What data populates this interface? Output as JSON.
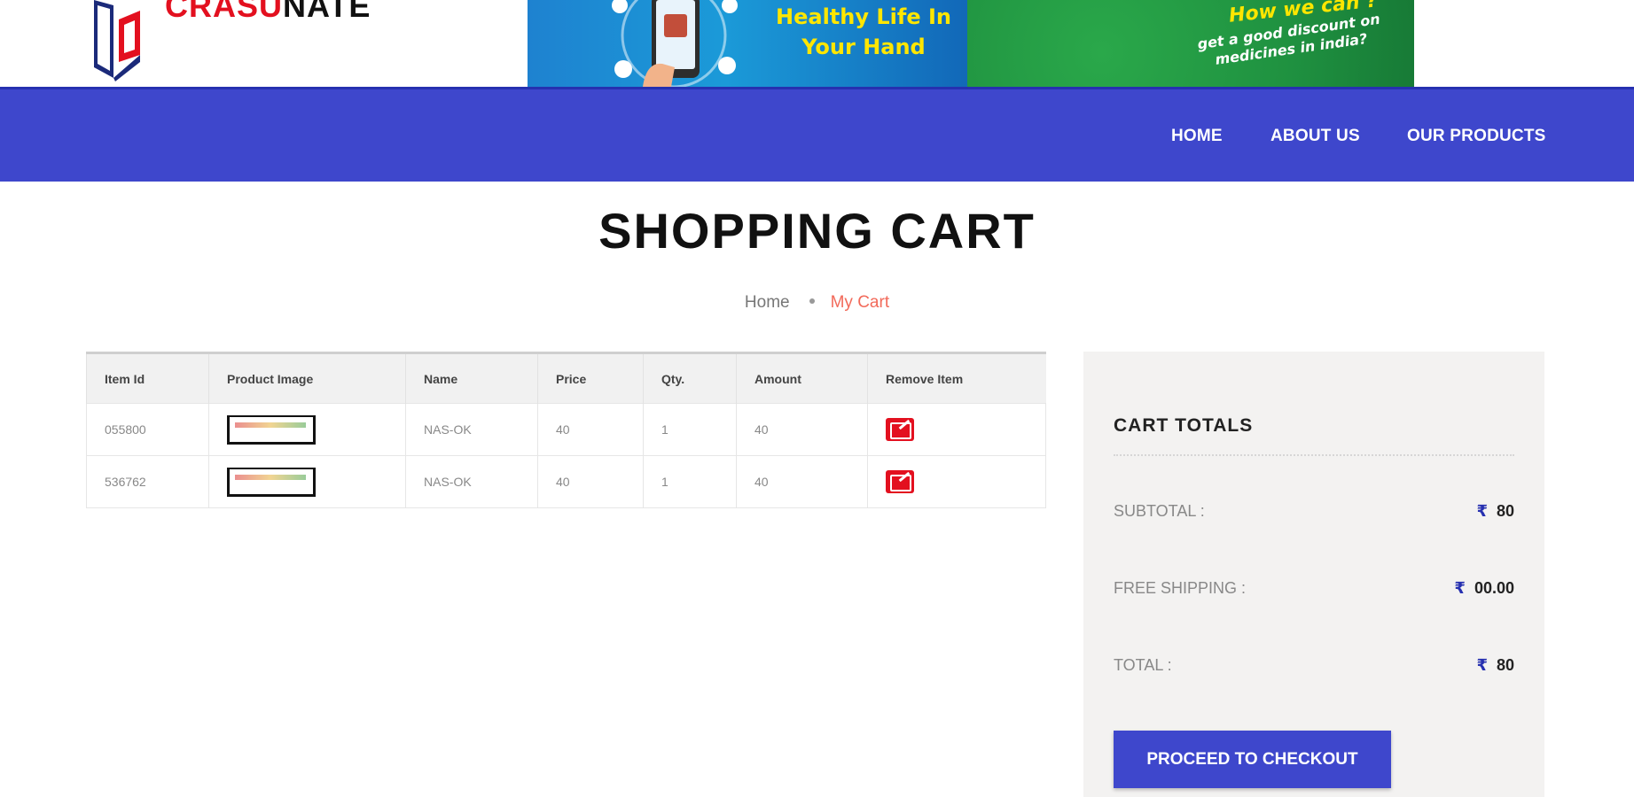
{
  "header": {
    "logo": {
      "text_red": "CRASU",
      "text_black": "NATE"
    },
    "banner": {
      "left_text": "Healthy Life In Your Hand",
      "right_text": "How we can ?",
      "right_subtext": "get a good discount on medicines in india?"
    }
  },
  "nav": {
    "items": [
      {
        "label": "HOME"
      },
      {
        "label": "ABOUT US"
      },
      {
        "label": "OUR PRODUCTS"
      }
    ]
  },
  "page": {
    "title": "SHOPPING CART",
    "breadcrumb": {
      "home": "Home",
      "current": "My Cart"
    }
  },
  "cart": {
    "columns": [
      "Item Id",
      "Product Image",
      "Name",
      "Price",
      "Qty.",
      "Amount",
      "Remove Item"
    ],
    "rows": [
      {
        "item_id": "055800",
        "name": "NAS-OK",
        "price": "40",
        "qty": "1",
        "amount": "40"
      },
      {
        "item_id": "536762",
        "name": "NAS-OK",
        "price": "40",
        "qty": "1",
        "amount": "40"
      }
    ]
  },
  "totals": {
    "title": "CART TOTALS",
    "currency_symbol": "₹",
    "subtotal": {
      "label": "SUBTOTAL :",
      "value": "80"
    },
    "shipping": {
      "label": "FREE SHIPPING :",
      "value": "00.00"
    },
    "total": {
      "label": "TOTAL :",
      "value": "80"
    },
    "checkout_label": "PROCEED TO CHECKOUT"
  },
  "colors": {
    "nav_bg": "#3e47cc",
    "brand_red": "#e3101f",
    "breadcrumb_active": "#f26a5a",
    "totals_bg": "#f3f2f1"
  }
}
